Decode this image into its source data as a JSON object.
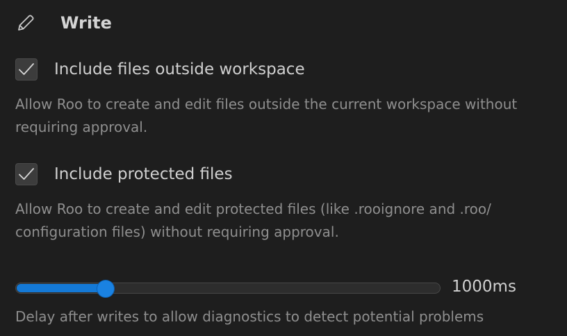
{
  "section": {
    "icon": "pencil-icon",
    "title": "Write"
  },
  "settings": [
    {
      "checked": true,
      "label": "Include files outside workspace",
      "description": "Allow Roo to create and edit files outside the current workspace without requiring approval."
    },
    {
      "checked": true,
      "label": "Include protected files",
      "description": "Allow Roo to create and edit protected files (like .rooignore and .roo/ configuration files) without requiring approval."
    }
  ],
  "delay_slider": {
    "value": 1000,
    "value_label": "1000ms",
    "fill_fraction": 0.21,
    "accent_color": "#1479d6",
    "description": "Delay after writes to allow diagnostics to detect potential problems"
  }
}
